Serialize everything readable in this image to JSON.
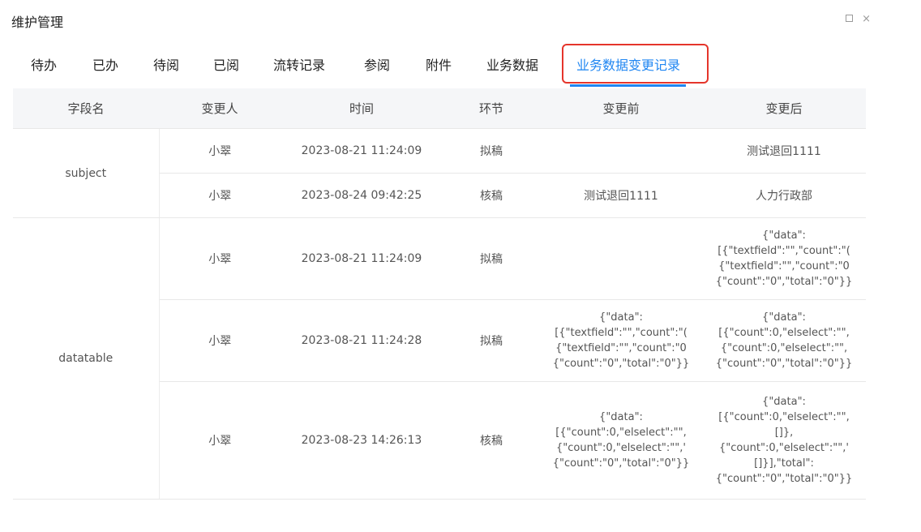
{
  "window": {
    "title": "维护管理",
    "maximize_label": "□",
    "close_label": "×"
  },
  "tabs": [
    {
      "label": "待办"
    },
    {
      "label": "已办"
    },
    {
      "label": "待阅"
    },
    {
      "label": "已阅"
    },
    {
      "label": "流转记录"
    },
    {
      "label": "参阅"
    },
    {
      "label": "附件"
    },
    {
      "label": "业务数据"
    },
    {
      "label": "业务数据变更记录",
      "active": true
    }
  ],
  "colors": {
    "accent": "#1f86f2",
    "highlight_border": "#e5352b",
    "header_bg": "#f5f6f8"
  },
  "table": {
    "columns": [
      "字段名",
      "变更人",
      "时间",
      "环节",
      "变更前",
      "变更后"
    ],
    "groups": [
      {
        "field": "subject",
        "rows": [
          {
            "user": "小翠",
            "time": "2023-08-21 11:24:09",
            "stage": "拟稿",
            "before": "",
            "after": "测试退回1111"
          },
          {
            "user": "小翠",
            "time": "2023-08-24 09:42:25",
            "stage": "核稿",
            "before": "测试退回1111",
            "after": "人力行政部"
          }
        ]
      },
      {
        "field": "datatable",
        "rows": [
          {
            "user": "小翠",
            "time": "2023-08-21 11:24:09",
            "stage": "拟稿",
            "before": "",
            "after": "{\"data\":\n[{\"textfield\":\"\",\"count\":\"(\n{\"textfield\":\"\",\"count\":\"0\n{\"count\":\"0\",\"total\":\"0\"}}"
          },
          {
            "user": "小翠",
            "time": "2023-08-21 11:24:28",
            "stage": "拟稿",
            "before": "{\"data\":\n[{\"textfield\":\"\",\"count\":\"(\n{\"textfield\":\"\",\"count\":\"0\n{\"count\":\"0\",\"total\":\"0\"}}",
            "after": "{\"data\":\n[{\"count\":0,\"elselect\":\"\",\n{\"count\":0,\"elselect\":\"\",\n{\"count\":\"0\",\"total\":\"0\"}}"
          },
          {
            "user": "小翠",
            "time": "2023-08-23 14:26:13",
            "stage": "核稿",
            "before": "{\"data\":\n[{\"count\":0,\"elselect\":\"\",\n{\"count\":0,\"elselect\":\"\",'\n{\"count\":\"0\",\"total\":\"0\"}}",
            "after": "{\"data\":\n[{\"count\":0,\"elselect\":\"\",\n[]},\n{\"count\":0,\"elselect\":\"\",'\n[]}],\"total\":\n{\"count\":\"0\",\"total\":\"0\"}}"
          }
        ]
      }
    ]
  }
}
